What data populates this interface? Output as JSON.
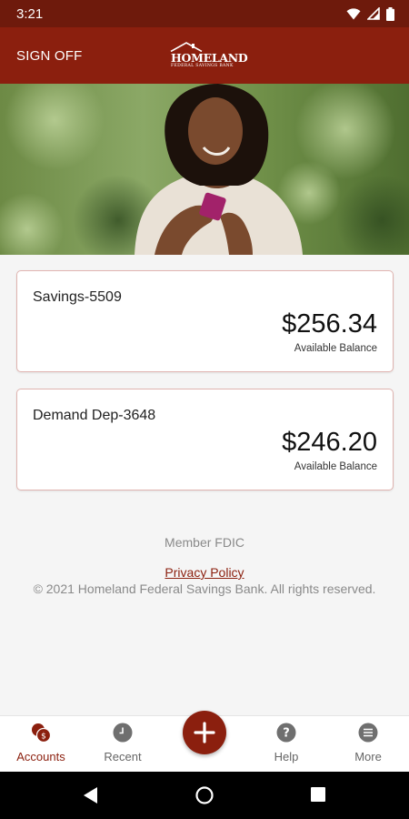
{
  "status_bar": {
    "time": "3:21"
  },
  "header": {
    "sign_off_label": "SIGN OFF",
    "logo": {
      "name": "HOMELAND",
      "subtitle": "FEDERAL SAVINGS BANK"
    }
  },
  "accounts": [
    {
      "name": "Savings-5509",
      "balance": "$256.34",
      "balance_label": "Available Balance"
    },
    {
      "name": "Demand Dep-3648",
      "balance": "$246.20",
      "balance_label": "Available Balance"
    }
  ],
  "footer": {
    "member_fdic": "Member FDIC",
    "privacy_policy": "Privacy Policy",
    "copyright": "© 2021 Homeland Federal Savings Bank. All rights reserved."
  },
  "bottom_nav": {
    "items": [
      {
        "label": "Accounts",
        "icon": "accounts-icon",
        "active": true
      },
      {
        "label": "Recent",
        "icon": "clock-icon"
      },
      {
        "label": "",
        "icon": "plus-icon"
      },
      {
        "label": "Help",
        "icon": "help-icon"
      },
      {
        "label": "More",
        "icon": "menu-icon"
      }
    ]
  },
  "colors": {
    "brand": "#8b1f0e",
    "status_bar": "#6e1a0c",
    "background": "#f5f5f5",
    "card_border": "#e0b4b0"
  }
}
